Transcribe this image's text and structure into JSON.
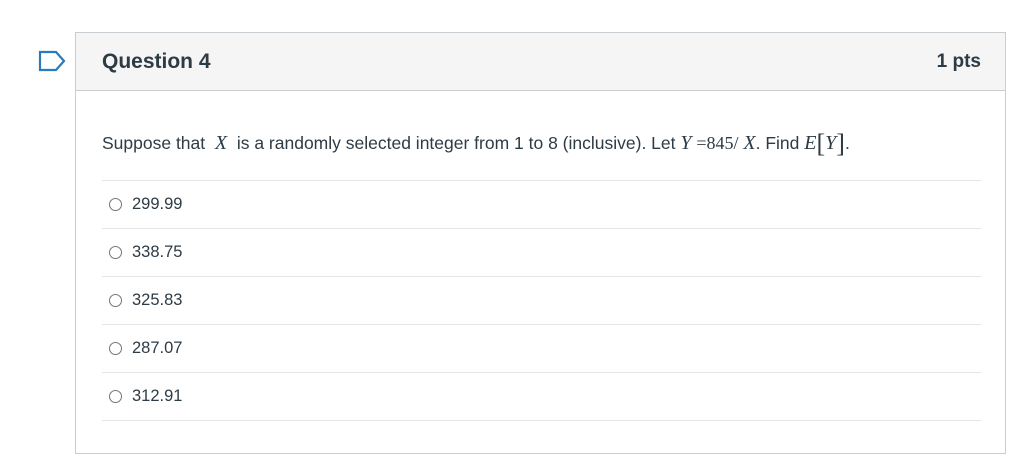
{
  "question": {
    "title": "Question 4",
    "points": "1 pts",
    "text": {
      "part1": "Suppose that",
      "var_x": "X",
      "part2": "is a randomly selected integer from 1 to 8 (inclusive). Let",
      "var_y": "Y",
      "eq": "=845/",
      "var_x2": "X",
      "part3": ". Find",
      "expect_e": "E",
      "bracket_open": "[",
      "var_y2": "Y",
      "bracket_close": "]",
      "period": "."
    },
    "answers": [
      {
        "label": "299.99"
      },
      {
        "label": "338.75"
      },
      {
        "label": "325.83"
      },
      {
        "label": "287.07"
      },
      {
        "label": "312.91"
      }
    ]
  },
  "colors": {
    "text": "#2d3b45",
    "border": "#c7cdd1",
    "header_bg": "#f5f5f5",
    "flag": "#2b7abc"
  },
  "icons": {
    "flag": "flag-question-icon"
  }
}
